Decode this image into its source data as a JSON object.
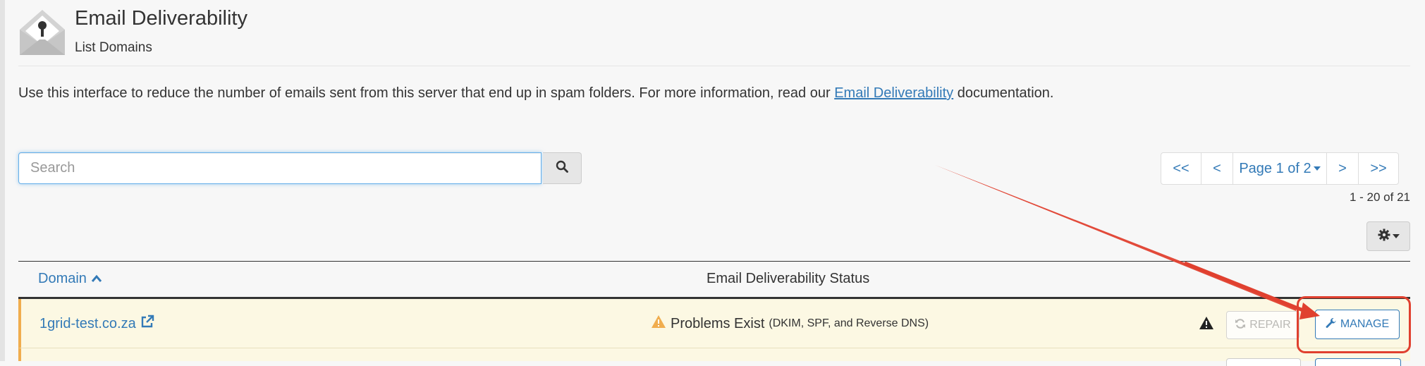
{
  "header": {
    "title": "Email Deliverability",
    "subtitle": "List Domains",
    "icon": "envelope-key-icon"
  },
  "intro": {
    "text_before": "Use this interface to reduce the number of emails sent from this server that end up in spam folders. For more information, read our ",
    "link": "Email Deliverability",
    "text_after": " documentation."
  },
  "search": {
    "placeholder": "Search",
    "value": "",
    "icon": "search-icon"
  },
  "pagination": {
    "first": "<<",
    "prev": "<",
    "page_label": "Page 1 of 2",
    "next": ">",
    "last": ">>",
    "range": "1 - 20 of 21"
  },
  "settings": {
    "icon": "gear-icon"
  },
  "table": {
    "columns": {
      "domain": "Domain",
      "status": "Email Deliverability Status"
    },
    "rows": [
      {
        "domain": "1grid-test.co.za",
        "status": "Problems Exist",
        "status_detail": "(DKIM, SPF, and Reverse DNS)",
        "repair_label": "REPAIR",
        "manage_label": "MANAGE"
      }
    ]
  },
  "colors": {
    "link": "#337ab7",
    "warning": "#f0ad4e",
    "row_bg": "#fcf8e3",
    "annotation": "#e0402f"
  }
}
